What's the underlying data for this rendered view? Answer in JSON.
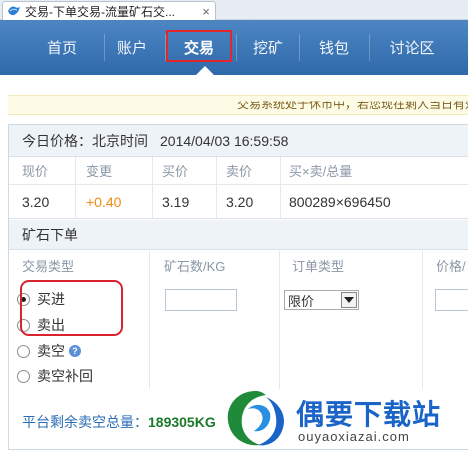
{
  "browser": {
    "tab_title": "交易-下单交易-流量矿石交...",
    "close_glyph": "×"
  },
  "nav": {
    "items": [
      {
        "label": "首页"
      },
      {
        "label": "账户"
      },
      {
        "label": "交易"
      },
      {
        "label": "挖矿"
      },
      {
        "label": "钱包"
      },
      {
        "label": "讨论区"
      }
    ],
    "active_index": 2,
    "highlight_color": "#e2262b"
  },
  "notice": {
    "text": "交易系统处于休市中，若您现在剩人当日有效系"
  },
  "price": {
    "label": "今日价格：北京时间",
    "datetime": "2014/04/03 16:59:58",
    "columns": [
      "现价",
      "变更",
      "买价",
      "卖价",
      "买×卖/总量"
    ],
    "values": [
      "3.20",
      "+0.40",
      "3.19",
      "3.20",
      "800289×696450"
    ],
    "up_color": "#f08a12"
  },
  "order": {
    "title": "矿石下单",
    "columns": [
      "交易类型",
      "矿石数/KG",
      "订单类型",
      "价格/"
    ],
    "trade_types": [
      {
        "label": "买进",
        "checked": true
      },
      {
        "label": "卖出",
        "checked": false
      },
      {
        "label": "卖空",
        "checked": false,
        "help": "?"
      },
      {
        "label": "卖空补回",
        "checked": false
      }
    ],
    "order_type_selected": "限价",
    "total_label": "平台剩余卖空总量：",
    "total_value": "189305KG"
  },
  "watermark": {
    "title": "偶要下载站",
    "url": "ouyaoxiazai.com"
  }
}
